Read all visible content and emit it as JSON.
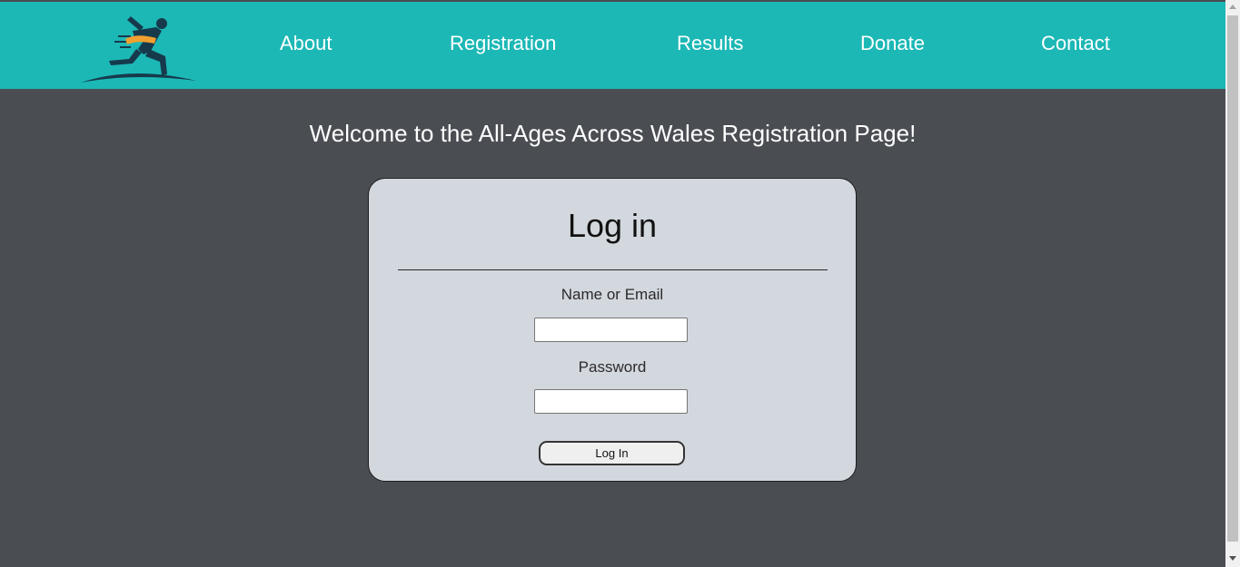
{
  "header": {
    "logo_icon": "running-athlete-logo-icon",
    "nav": [
      {
        "label": "About"
      },
      {
        "label": "Registration"
      },
      {
        "label": "Results"
      },
      {
        "label": "Donate"
      },
      {
        "label": "Contact"
      }
    ]
  },
  "main": {
    "welcome": "Welcome to the All-Ages Across Wales Registration Page!"
  },
  "login": {
    "title": "Log in",
    "name_label": "Name or Email",
    "name_value": "",
    "password_label": "Password",
    "password_value": "",
    "button_label": "Log In"
  },
  "colors": {
    "header_bg": "#1cb8b6",
    "page_bg": "#4a4d52",
    "card_bg": "#d3d7de",
    "logo_accent": "#f0a030",
    "logo_dark": "#163a4c"
  }
}
